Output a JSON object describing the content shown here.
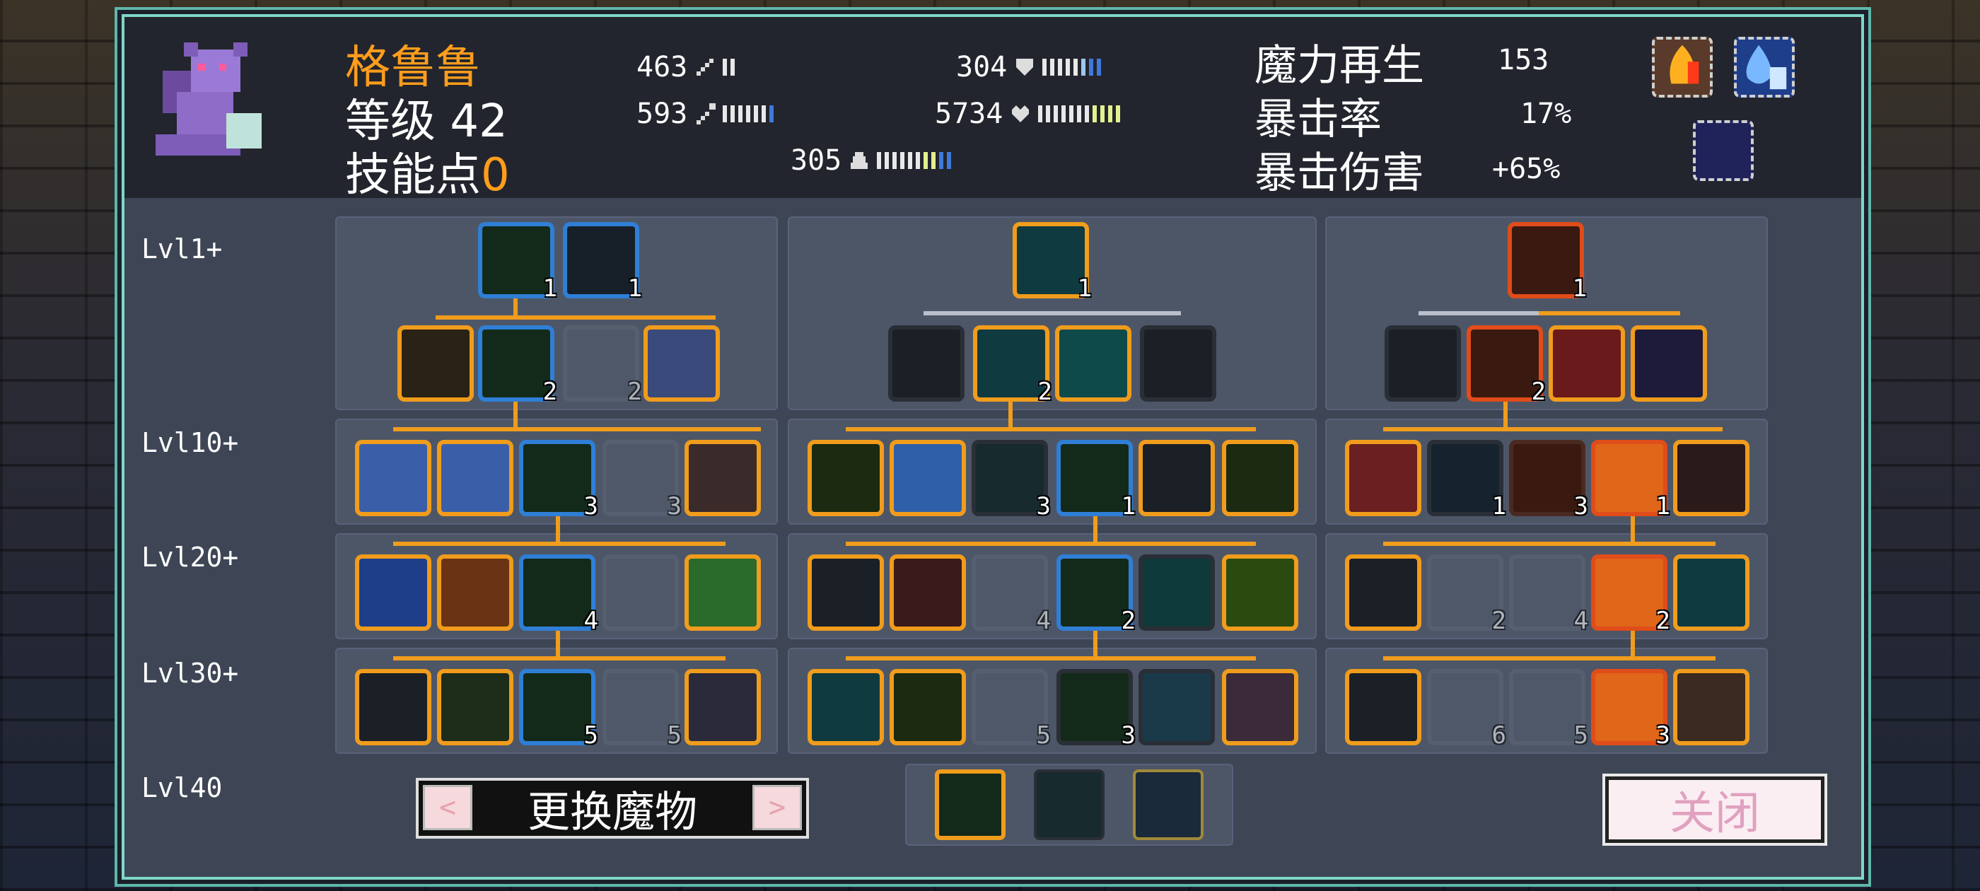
{
  "character": {
    "name": "格鲁鲁",
    "level_label": "等级",
    "level": "42",
    "skill_points_label": "技能点",
    "skill_points": "0"
  },
  "stats_left": [
    {
      "value": "463",
      "icon": "sword-icon"
    },
    {
      "value": "593",
      "icon": "staff-icon"
    },
    {
      "value": "305",
      "icon": "helmet-icon"
    }
  ],
  "stats_mid": [
    {
      "value": "304",
      "icon": "shield-icon"
    },
    {
      "value": "5734",
      "icon": "heart-icon"
    }
  ],
  "stats_right": [
    {
      "label": "魔力再生",
      "value": "153"
    },
    {
      "label": "暴击率",
      "value": "17%"
    },
    {
      "label": "暴击伤害",
      "value": "+65%"
    }
  ],
  "level_labels": [
    "Lvl1+",
    "Lvl10+",
    "Lvl20+",
    "Lvl30+",
    "Lvl40"
  ],
  "skill_counts": {
    "t1_r0_a": "1",
    "t1_r0_b": "1",
    "t1_r1_b": "2",
    "t1_r1_c": "2",
    "t1_r2_c": "3",
    "t1_r2_d": "3",
    "t1_r3_c": "4",
    "t1_r4_c": "5",
    "t1_r4_d": "5",
    "t2_r0": "1",
    "t2_r1_b": "2",
    "t2_r2_c": "3",
    "t2_r2_d": "1",
    "t2_r3_c": "4",
    "t2_r3_d": "2",
    "t2_r4_c": "5",
    "t2_r4_d": "3",
    "t3_r0": "1",
    "t3_r1_b": "2",
    "t3_r2_b": "1",
    "t3_r2_c": "3",
    "t3_r2_d": "1",
    "t3_r3_b": "2",
    "t3_r3_c": "4",
    "t3_r3_d": "2",
    "t3_r4_b": "6",
    "t3_r4_c": "5",
    "t3_r4_d": "3"
  },
  "buttons": {
    "swap_monster": "更换魔物",
    "prev": "<",
    "next": ">",
    "close": "关闭"
  },
  "colors": {
    "accent_orange": "#f09c1c",
    "frame_teal": "#7fd6c8",
    "name_orange": "#ff9d1c"
  }
}
